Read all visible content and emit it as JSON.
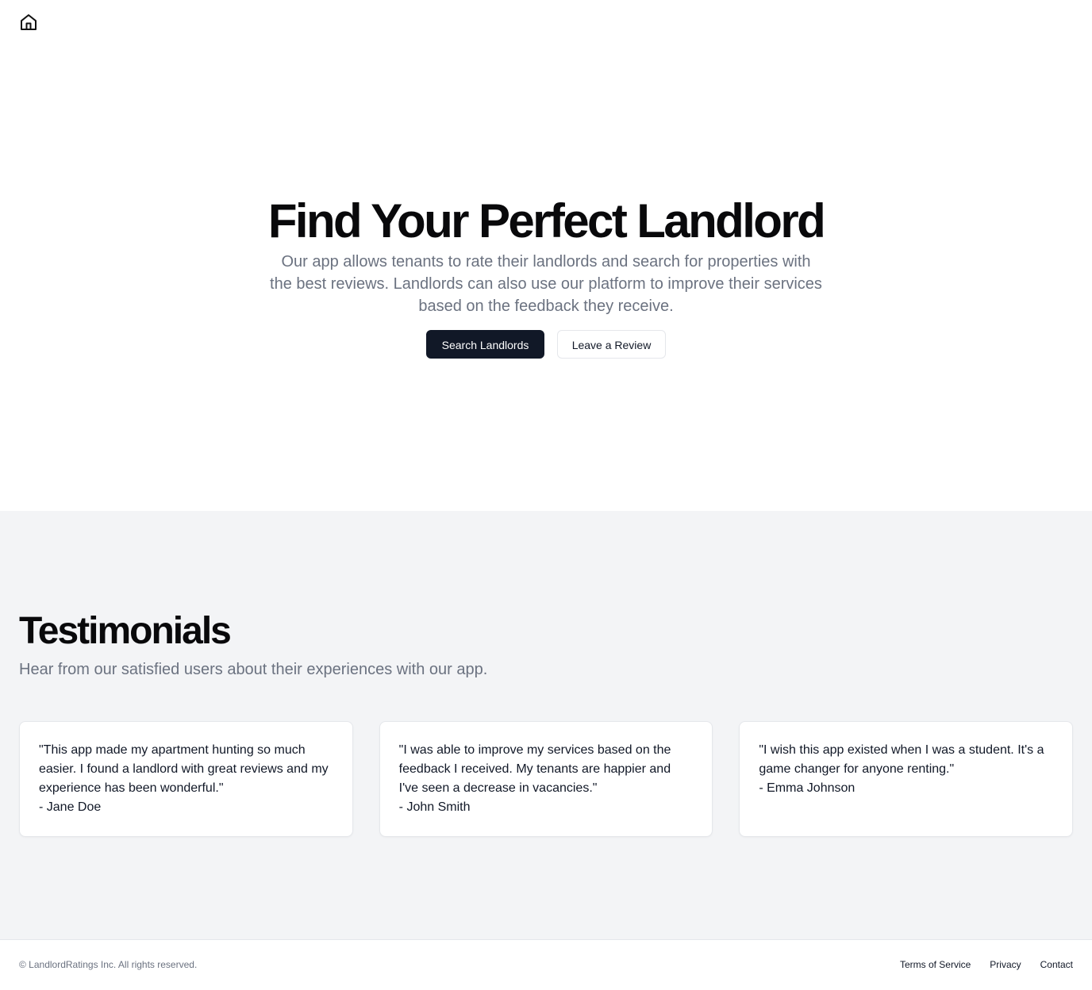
{
  "header": {
    "home_icon": "home-icon"
  },
  "hero": {
    "title": "Find Your Perfect Landlord",
    "description": "Our app allows tenants to rate their landlords and search for properties with the best reviews. Landlords can also use our platform to improve their services based on the feedback they receive.",
    "primary_button": "Search Landlords",
    "secondary_button": "Leave a Review"
  },
  "testimonials": {
    "title": "Testimonials",
    "subtitle": "Hear from our satisfied users about their experiences with our app.",
    "items": [
      {
        "quote": "\"This app made my apartment hunting so much easier. I found a landlord with great reviews and my experience has been wonderful.\"",
        "author": "- Jane Doe"
      },
      {
        "quote": "\"I was able to improve my services based on the feedback I received. My tenants are happier and I've seen a decrease in vacancies.\"",
        "author": "- John Smith"
      },
      {
        "quote": "\"I wish this app existed when I was a student. It's a game changer for anyone renting.\"",
        "author": "- Emma Johnson"
      }
    ]
  },
  "footer": {
    "copyright": "© LandlordRatings Inc. All rights reserved.",
    "links": [
      "Terms of Service",
      "Privacy",
      "Contact"
    ]
  },
  "colors": {
    "primary": "#111827",
    "muted_text": "#6b7280",
    "section_bg": "#f3f4f6",
    "border": "#e5e7eb"
  }
}
